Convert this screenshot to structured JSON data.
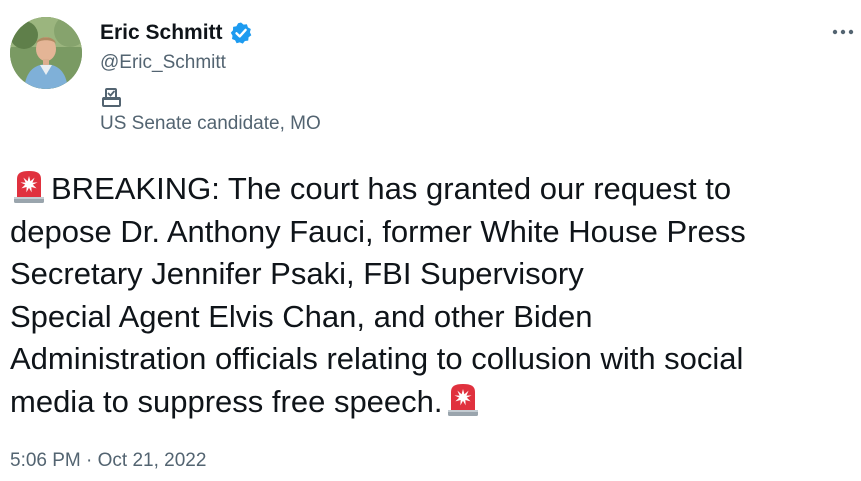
{
  "author": {
    "display_name": "Eric Schmitt",
    "handle": "@Eric_Schmitt",
    "verified": true,
    "label_icon": "ballot-box-icon",
    "label": "US Senate candidate, MO"
  },
  "tweet": {
    "lines": [
      "BREAKING: The court has granted our request to",
      "depose Dr. Anthony Fauci, former White House Press",
      "Secretary Jennifer Psaki, FBI Supervisory",
      "Special Agent Elvis Chan, and other Biden",
      "Administration officials relating to collusion with social",
      "media to suppress free speech."
    ],
    "leading_emoji": "police-light-emoji",
    "trailing_emoji": "police-light-emoji"
  },
  "timestamp": "5:06 PM · Oct 21, 2022",
  "colors": {
    "primary_text": "#0f1419",
    "secondary_text": "#536471",
    "verified_blue": "#1d9bf0",
    "siren_red": "#e0313e"
  },
  "icons": {
    "more": "more-options-icon",
    "verified": "verified-badge-icon"
  }
}
